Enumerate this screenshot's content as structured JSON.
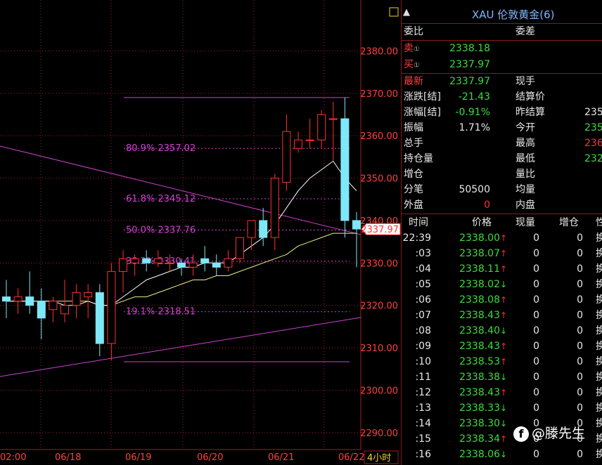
{
  "chart_data": {
    "type": "candlestick",
    "timeframe_label": "4小时",
    "x_tick_labels": [
      "02:00",
      "06/18",
      "06/19",
      "06/20",
      "06/21",
      "06/22"
    ],
    "y_ticks": [
      2290,
      2300,
      2310,
      2320,
      2330,
      2340,
      2350,
      2360,
      2370,
      2380
    ],
    "y_tick_labels": [
      "2290.00",
      "2300.00",
      "2310.00",
      "2320.00",
      "2330.00",
      "2340.00",
      "2350.00",
      "2360.00",
      "2370.00",
      "2380.00"
    ],
    "ylim": [
      2286,
      2392
    ],
    "current_price_label": "2337.97",
    "current_price": 2337.97,
    "fib_levels": [
      {
        "label": "80.9% 2357.02",
        "value": 2357.02
      },
      {
        "label": "61.8% 2345.12",
        "value": 2345.12
      },
      {
        "label": "50.0% 2337.76",
        "value": 2337.76
      },
      {
        "label": "38.2% 2330.41",
        "value": 2330.41
      },
      {
        "label": "19.1% 2318.51",
        "value": 2318.51
      }
    ],
    "fib_top": 2369.0,
    "fib_bottom": 2306.7,
    "candles": [
      {
        "o": 2322,
        "h": 2326,
        "l": 2317,
        "c": 2321
      },
      {
        "o": 2321,
        "h": 2324,
        "l": 2318,
        "c": 2322
      },
      {
        "o": 2322,
        "h": 2328,
        "l": 2318,
        "c": 2320
      },
      {
        "o": 2321,
        "h": 2324,
        "l": 2312,
        "c": 2317
      },
      {
        "o": 2319,
        "h": 2322,
        "l": 2316,
        "c": 2321
      },
      {
        "o": 2318,
        "h": 2326,
        "l": 2316,
        "c": 2320
      },
      {
        "o": 2320,
        "h": 2325,
        "l": 2317,
        "c": 2323
      },
      {
        "o": 2322,
        "h": 2325,
        "l": 2317,
        "c": 2323
      },
      {
        "o": 2323,
        "h": 2325,
        "l": 2308,
        "c": 2311
      },
      {
        "o": 2311,
        "h": 2330,
        "l": 2307,
        "c": 2328
      },
      {
        "o": 2328,
        "h": 2333,
        "l": 2323,
        "c": 2331
      },
      {
        "o": 2330,
        "h": 2332,
        "l": 2327,
        "c": 2331
      },
      {
        "o": 2331,
        "h": 2333,
        "l": 2328,
        "c": 2330
      },
      {
        "o": 2330,
        "h": 2333,
        "l": 2329,
        "c": 2331
      },
      {
        "o": 2330,
        "h": 2332,
        "l": 2328,
        "c": 2330
      },
      {
        "o": 2330,
        "h": 2331,
        "l": 2327,
        "c": 2329
      },
      {
        "o": 2329,
        "h": 2332,
        "l": 2327,
        "c": 2330
      },
      {
        "o": 2331,
        "h": 2334,
        "l": 2328,
        "c": 2330
      },
      {
        "o": 2330,
        "h": 2332,
        "l": 2327,
        "c": 2329
      },
      {
        "o": 2329,
        "h": 2333,
        "l": 2328,
        "c": 2331
      },
      {
        "o": 2331,
        "h": 2335,
        "l": 2330,
        "c": 2336
      },
      {
        "o": 2336,
        "h": 2340,
        "l": 2333,
        "c": 2340
      },
      {
        "o": 2340,
        "h": 2343,
        "l": 2334,
        "c": 2336
      },
      {
        "o": 2336,
        "h": 2351,
        "l": 2333,
        "c": 2350
      },
      {
        "o": 2349,
        "h": 2365,
        "l": 2347,
        "c": 2361
      },
      {
        "o": 2357,
        "h": 2361,
        "l": 2356,
        "c": 2359
      },
      {
        "o": 2359,
        "h": 2364,
        "l": 2357,
        "c": 2359
      },
      {
        "o": 2359,
        "h": 2366,
        "l": 2357,
        "c": 2365
      },
      {
        "o": 2364,
        "h": 2368,
        "l": 2354,
        "c": 2364
      },
      {
        "o": 2364,
        "h": 2369,
        "l": 2336,
        "c": 2340
      },
      {
        "o": 2340,
        "h": 2342,
        "l": 2329,
        "c": 2338
      }
    ],
    "ma_short": [
      2321,
      2321,
      2321,
      2321,
      2321,
      2320,
      2320,
      2321,
      2320,
      2320,
      2322,
      2324,
      2326,
      2327,
      2328,
      2329,
      2329,
      2330,
      2330,
      2330,
      2332,
      2334,
      2336,
      2339,
      2343,
      2347,
      2350,
      2352,
      2354,
      2350,
      2347
    ],
    "ma_long": [
      2321,
      2321,
      2321,
      2321,
      2321,
      2321,
      2321,
      2321,
      2320,
      2320,
      2321,
      2322,
      2322,
      2323,
      2324,
      2325,
      2326,
      2326,
      2327,
      2327,
      2328,
      2329,
      2330,
      2331,
      2332,
      2334,
      2335,
      2336,
      2337,
      2337,
      2337
    ]
  },
  "panel": {
    "title": "XAU 伦敦黄金(6)",
    "warn_icon": "warning-icon",
    "weibi_label": "委比",
    "weicha_label": "委差",
    "sell_label": "卖",
    "sell_value": "2338.18",
    "buy_label": "买",
    "buy_value": "2337.97",
    "info_icon": "①",
    "rows": [
      {
        "l": "最新",
        "v": "2337.97",
        "vc": "green",
        "lred": true,
        "l2": "现手",
        "v2": "",
        "v2c": "green"
      },
      {
        "l": "涨跌[结]",
        "v": "-21.43",
        "vc": "green",
        "l2": "结算价",
        "v2": "",
        "v2c": "green"
      },
      {
        "l": "涨幅[结]",
        "v": "-0.91%",
        "vc": "green",
        "l2": "昨结算",
        "v2": "235",
        "v2c": "white"
      },
      {
        "l": "振幅",
        "v": "1.71%",
        "vc": "white",
        "l2": "今开",
        "v2": "235",
        "v2c": "green"
      },
      {
        "l": "总手",
        "v": "",
        "vc": "white",
        "l2": "最高",
        "v2": "236",
        "v2c": "red"
      },
      {
        "l": "持仓量",
        "v": "",
        "vc": "white",
        "l2": "最低",
        "v2": "232",
        "v2c": "green"
      },
      {
        "l": "增仓",
        "v": "",
        "vc": "white",
        "l2": "量比",
        "v2": "",
        "v2c": "white"
      },
      {
        "l": "分笔",
        "v": "50500",
        "vc": "white",
        "l2": "均量",
        "v2": "",
        "v2c": "white"
      },
      {
        "l": "外盘",
        "v": "0",
        "vc": "red",
        "l2": "内盘",
        "v2": "",
        "v2c": "white"
      }
    ],
    "table_headers": [
      "时间",
      "价格",
      "现量",
      "增仓",
      "性"
    ],
    "ticks": [
      {
        "t": "22:39",
        "p": "2338.00",
        "d": "up",
        "q": "0",
        "z": "0",
        "x": "换"
      },
      {
        "t": ":03",
        "p": "2338.07",
        "d": "up",
        "q": "0",
        "z": "0",
        "x": "换"
      },
      {
        "t": ":04",
        "p": "2338.11",
        "d": "up",
        "q": "0",
        "z": "0",
        "x": "换"
      },
      {
        "t": ":05",
        "p": "2338.02",
        "d": "down",
        "q": "0",
        "z": "0",
        "x": "换"
      },
      {
        "t": ":06",
        "p": "2338.08",
        "d": "up",
        "q": "0",
        "z": "0",
        "x": "换"
      },
      {
        "t": ":07",
        "p": "2338.43",
        "d": "up",
        "q": "0",
        "z": "0",
        "x": "换"
      },
      {
        "t": ":08",
        "p": "2338.40",
        "d": "down",
        "q": "0",
        "z": "0",
        "x": "换"
      },
      {
        "t": ":09",
        "p": "2338.43",
        "d": "up",
        "q": "0",
        "z": "0",
        "x": "换"
      },
      {
        "t": ":10",
        "p": "2338.53",
        "d": "up",
        "q": "0",
        "z": "0",
        "x": "换"
      },
      {
        "t": ":11",
        "p": "2338.38",
        "d": "down",
        "q": "0",
        "z": "0",
        "x": "换"
      },
      {
        "t": ":12",
        "p": "2338.43",
        "d": "up",
        "q": "0",
        "z": "0",
        "x": "换"
      },
      {
        "t": ":13",
        "p": "2338.33",
        "d": "down",
        "q": "0",
        "z": "0",
        "x": "换"
      },
      {
        "t": ":14",
        "p": "2338.30",
        "d": "down",
        "q": "0",
        "z": "0",
        "x": "换"
      },
      {
        "t": ":15",
        "p": "2338.34",
        "d": "up",
        "q": "0",
        "z": "0",
        "x": "换"
      },
      {
        "t": ":16",
        "p": "2338.06",
        "d": "down",
        "q": "0",
        "z": "0",
        "x": "换"
      }
    ],
    "up_arrow": "↑",
    "down_arrow": "↓"
  },
  "watermark": {
    "text": "@滕先生",
    "icon": "facebook-icon",
    "icon_glyph": "f"
  },
  "colors": {
    "up_candle": "#ff3030",
    "down_candle": "#7de8f8",
    "fib": "#d040d0",
    "ma_short": "#ffffff",
    "ma_long": "#f0f080",
    "grid": "#a02020",
    "axis_text": "#ff4040"
  }
}
